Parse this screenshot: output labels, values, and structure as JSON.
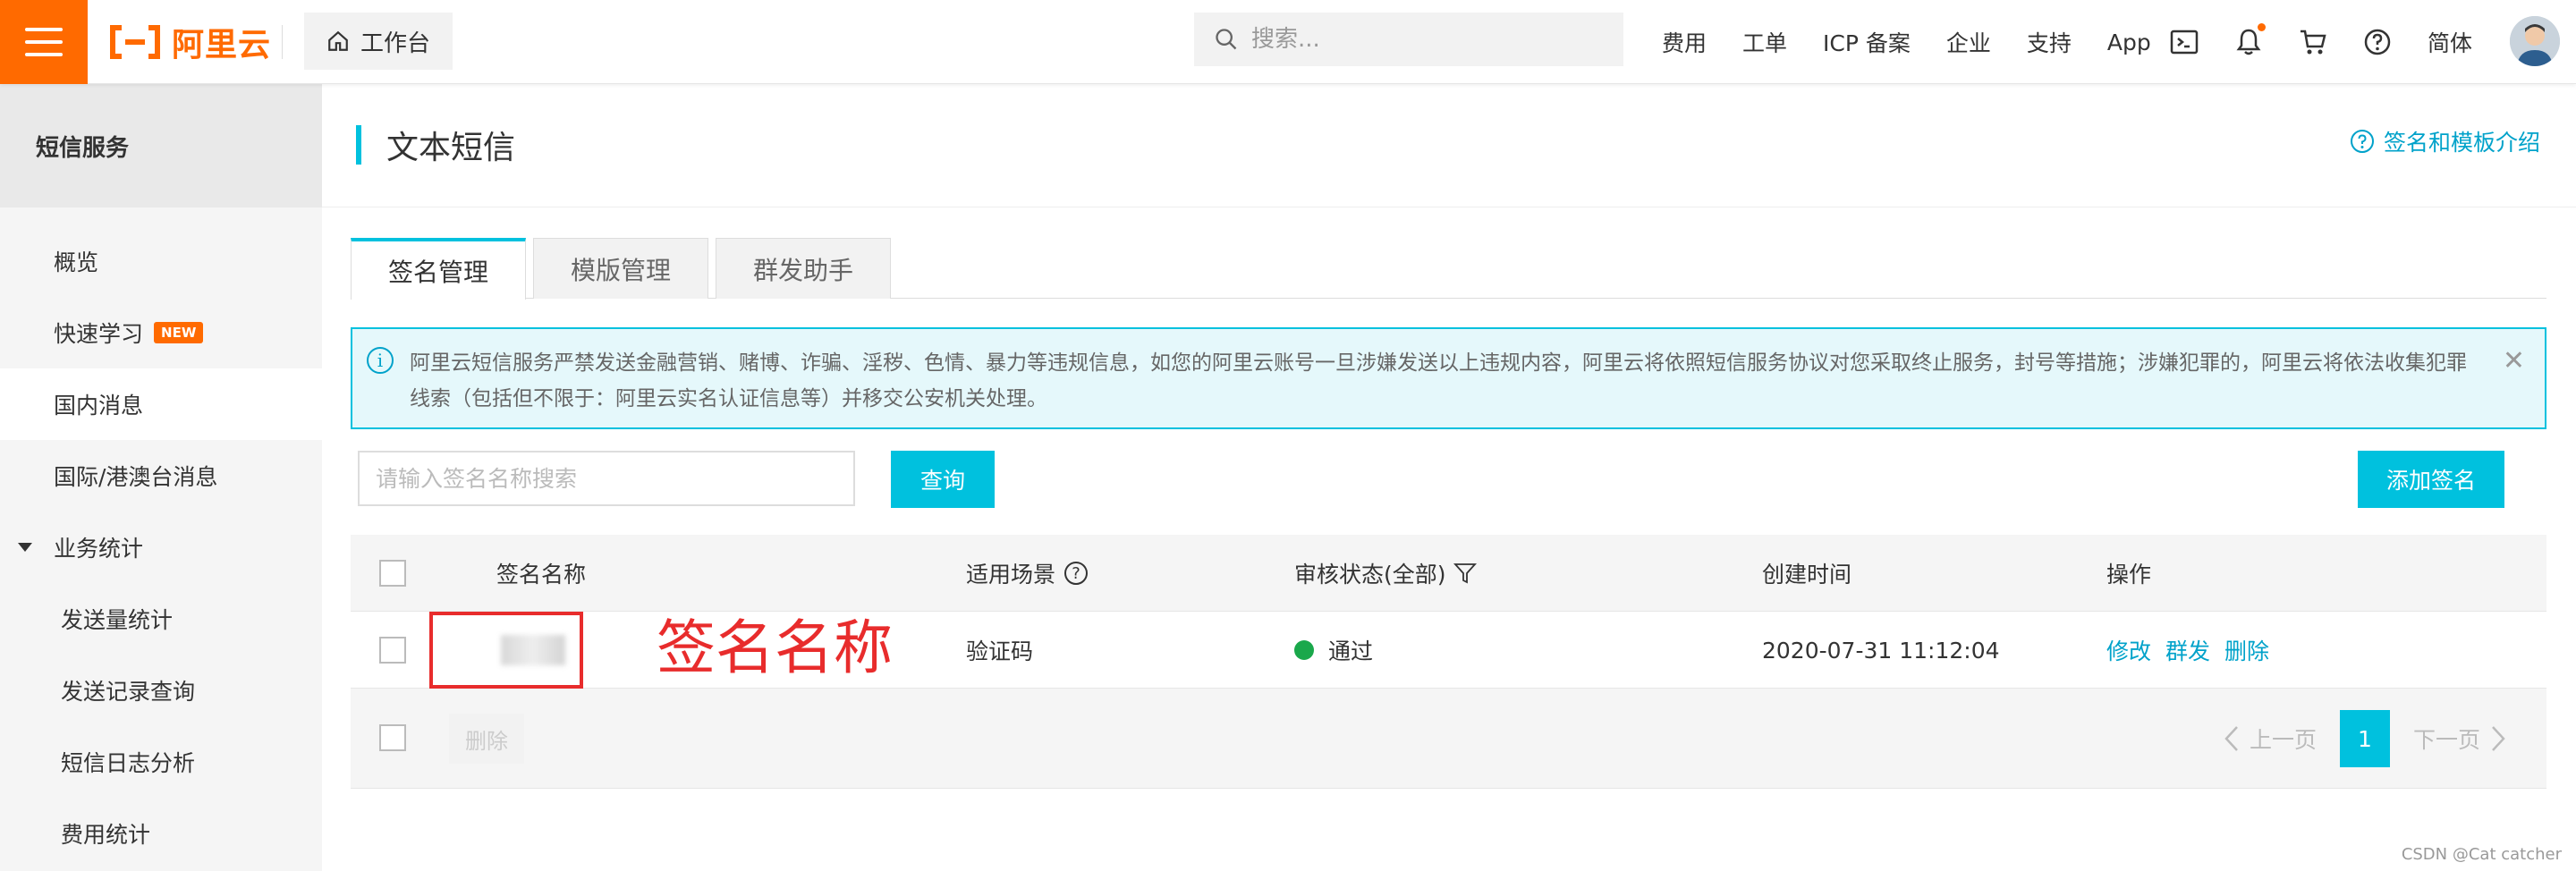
{
  "topbar": {
    "brand": "阿里云",
    "workbench": "工作台",
    "search_placeholder": "搜索...",
    "links": [
      "费用",
      "工单",
      "ICP 备案",
      "企业",
      "支持",
      "App"
    ],
    "lang": "简体",
    "accent_color": "#ff6a00"
  },
  "sidebar": {
    "title": "短信服务",
    "items": {
      "overview": "概览",
      "quick_learn": "快速学习",
      "new_badge": "NEW",
      "domestic": "国内消息",
      "international": "国际/港澳台消息",
      "stats_group": "业务统计",
      "send_volume": "发送量统计",
      "send_records": "发送记录查询",
      "log_analysis": "短信日志分析",
      "cost_stats": "费用统计"
    }
  },
  "main": {
    "page_title": "文本短信",
    "help_link": "签名和模板介绍",
    "tabs": [
      "签名管理",
      "模版管理",
      "群发助手"
    ],
    "notice": "阿里云短信服务严禁发送金融营销、赌博、诈骗、淫秽、色情、暴力等违规信息，如您的阿里云账号一旦涉嫌发送以上违规内容，阿里云将依照短信服务协议对您采取终止服务，封号等措施；涉嫌犯罪的，阿里云将依法收集犯罪线索（包括但不限于：阿里云实名认证信息等）并移交公安机关处理。",
    "sign_search_placeholder": "请输入签名名称搜索",
    "query_button": "查询",
    "add_button": "添加签名",
    "accent_color": "#00c1de"
  },
  "table": {
    "headers": {
      "name": "签名名称",
      "scene": "适用场景",
      "status": "审核状态(全部)",
      "created": "创建时间",
      "actions": "操作"
    },
    "rows": [
      {
        "scene": "验证码",
        "status": "通过",
        "created": "2020-07-31 11:12:04",
        "actions": [
          "修改",
          "群发",
          "删除"
        ]
      }
    ],
    "footer": {
      "delete": "删除",
      "prev": "上一页",
      "page": "1",
      "next": "下一页"
    }
  },
  "annotation": {
    "label": "签名名称",
    "color": "#e82c2c"
  },
  "watermark": "CSDN @Cat catcher"
}
